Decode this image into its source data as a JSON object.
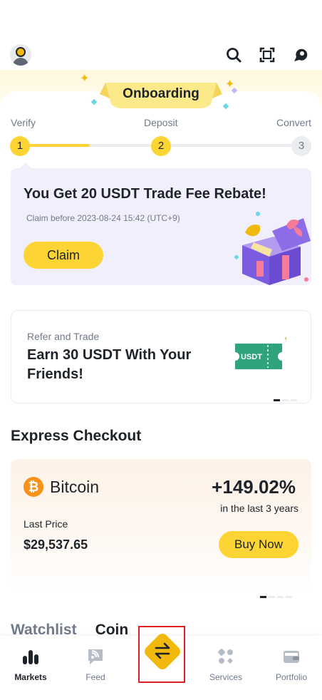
{
  "topbar": {
    "icons": [
      "avatar-icon",
      "search-icon",
      "scan-icon",
      "support-icon"
    ]
  },
  "onboarding": {
    "ribbon_label": "Onboarding",
    "steps": [
      {
        "label": "Verify",
        "number": "1",
        "state": "active"
      },
      {
        "label": "Deposit",
        "number": "2",
        "state": "active"
      },
      {
        "label": "Convert",
        "number": "3",
        "state": "idle"
      }
    ],
    "progress_fraction": 0.25
  },
  "rebate_card": {
    "title": "You Get 20 USDT Trade Fee Rebate!",
    "subtitle": "Claim before 2023-08-24 15:42 (UTC+9)",
    "button": "Claim",
    "illustration": "gift-box-icon"
  },
  "refer_card": {
    "small_label": "Refer and Trade",
    "title": "Earn 30 USDT With Your Friends!",
    "ticket_text": "USDT",
    "illustration": "ticket-icon",
    "pager": {
      "count": 3,
      "active": 0
    }
  },
  "express_checkout": {
    "section_title": "Express Checkout",
    "coin_name": "Bitcoin",
    "coin_icon": "bitcoin-icon",
    "change": "+149.02%",
    "change_period": "in the last 3 years",
    "last_price_label": "Last Price",
    "last_price": "$29,537.65",
    "button": "Buy Now",
    "pager": {
      "count": 4,
      "active": 0
    }
  },
  "tabs_partial": [
    "Watchlist",
    "Coin"
  ],
  "bottom_nav": {
    "items": [
      {
        "label": "Markets",
        "icon": "markets-icon",
        "active": true
      },
      {
        "label": "Feed",
        "icon": "feed-icon",
        "active": false
      },
      {
        "label": "",
        "icon": "trade-icon",
        "active": false
      },
      {
        "label": "Services",
        "icon": "services-icon",
        "active": false
      },
      {
        "label": "Portfolio",
        "icon": "portfolio-icon",
        "active": false
      }
    ]
  },
  "colors": {
    "brand_yellow": "#fcd535",
    "text_primary": "#1e2329",
    "text_secondary": "#707a8a",
    "rebate_bg": "#f1effc",
    "highlight_box": "#e02020"
  }
}
